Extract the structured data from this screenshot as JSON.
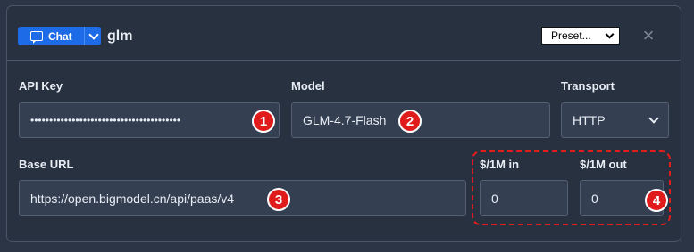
{
  "header": {
    "chat_button": {
      "label": "Chat"
    },
    "title": "glm",
    "preset": {
      "selected": "Preset..."
    },
    "close_symbol": "×"
  },
  "fields": {
    "api_key": {
      "label": "API Key",
      "value": "••••••••••••••••••••••••••••••••••••••••"
    },
    "model": {
      "label": "Model",
      "value": "GLM-4.7-Flash"
    },
    "transport": {
      "label": "Transport",
      "value": "HTTP"
    },
    "base_url": {
      "label": "Base URL",
      "value": "https://open.bigmodel.cn/api/paas/v4"
    },
    "price_in": {
      "label": "$/1M in",
      "value": "0"
    },
    "price_out": {
      "label": "$/1M out",
      "value": "0"
    }
  },
  "annotations": {
    "b1": "1",
    "b2": "2",
    "b3": "3",
    "b4": "4"
  },
  "colors": {
    "accent": "#1d6be6",
    "badge": "#e01b1b",
    "panel": "#283140",
    "field": "#343f52"
  }
}
